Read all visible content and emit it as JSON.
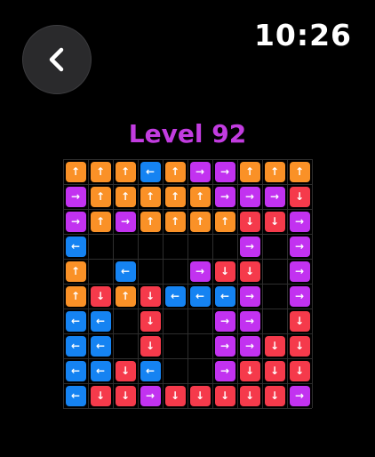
{
  "status_bar": {
    "time": "10:26"
  },
  "header": {
    "title": "Level 92",
    "back_icon": "chevron-left-icon"
  },
  "colors": {
    "background": "#000000",
    "title": "#c23ce0",
    "grid_line": "#2e2e2e",
    "tile": {
      "up": "#fa9127",
      "right": "#c232f0",
      "left": "#1583f2",
      "down": "#f53a4b"
    }
  },
  "arrow_glyphs": {
    "up": "↑",
    "down": "↓",
    "left": "←",
    "right": "→"
  },
  "board": {
    "rows": 10,
    "cols": 10,
    "cells": [
      [
        "up",
        "up",
        "up",
        "left",
        "up",
        "right",
        "right",
        "up",
        "up",
        "up"
      ],
      [
        "right",
        "up",
        "up",
        "up",
        "up",
        "up",
        "right",
        "right",
        "right",
        "down"
      ],
      [
        "right",
        "up",
        "right",
        "up",
        "up",
        "up",
        "up",
        "down",
        "down",
        "right"
      ],
      [
        "left",
        null,
        null,
        null,
        null,
        null,
        null,
        "right",
        null,
        "right"
      ],
      [
        "up",
        null,
        "left",
        null,
        null,
        "right",
        "down",
        "down",
        null,
        "right"
      ],
      [
        "up",
        "down",
        "up",
        "down",
        "left",
        "left",
        "left",
        "right",
        null,
        "right"
      ],
      [
        "left",
        "left",
        null,
        "down",
        null,
        null,
        "right",
        "right",
        null,
        "down"
      ],
      [
        "left",
        "left",
        null,
        "down",
        null,
        null,
        "right",
        "right",
        "down",
        "down"
      ],
      [
        "left",
        "left",
        "down",
        "left",
        null,
        null,
        "right",
        "down",
        "down",
        "down"
      ],
      [
        "left",
        "down",
        "down",
        "right",
        "down",
        "down",
        "down",
        "down",
        "down",
        "right"
      ]
    ]
  }
}
